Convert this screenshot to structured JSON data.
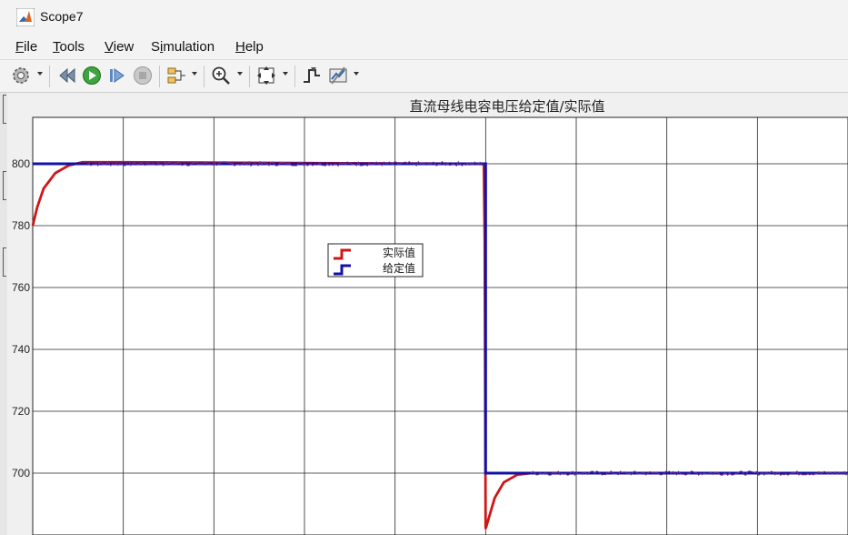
{
  "window": {
    "title": "Scope7",
    "app_icon": "matlab-icon"
  },
  "menu": {
    "items": [
      {
        "label": "File",
        "mnemonic": "F"
      },
      {
        "label": "Tools",
        "mnemonic": "T"
      },
      {
        "label": "View",
        "mnemonic": "V"
      },
      {
        "label": "Simulation",
        "mnemonic": "i"
      },
      {
        "label": "Help",
        "mnemonic": "H"
      }
    ]
  },
  "toolbar": {
    "buttons": [
      "settings-gear-icon",
      "step-back-icon",
      "run-icon",
      "step-forward-icon",
      "stop-icon",
      "highlight-signal-icon",
      "zoom-in-icon",
      "fit-to-view-icon",
      "triggers-icon",
      "measurements-icon"
    ]
  },
  "colors": {
    "actual": "#d01515",
    "setpoint": "#0f12a8",
    "grid": "#262626",
    "axes_bg": "#ffffff",
    "measured_trace": "#6a2a90"
  },
  "chart_data": {
    "type": "line",
    "title": "直流母线电容电压给定值/实际值",
    "ylim": [
      680,
      815
    ],
    "y_ticks": [
      700,
      720,
      740,
      760,
      780,
      800
    ],
    "x_divisions": 9,
    "grid": true,
    "legend_placement": "center-left",
    "series": [
      {
        "name": "实际值",
        "color": "#d01515",
        "points": [
          [
            0,
            780
          ],
          [
            0.05,
            786
          ],
          [
            0.12,
            792
          ],
          [
            0.25,
            797
          ],
          [
            0.4,
            799.5
          ],
          [
            0.55,
            800.5
          ],
          [
            1.0,
            800.5
          ],
          [
            4.98,
            800
          ],
          [
            4.99,
            775
          ],
          [
            5.0,
            682
          ],
          [
            5.04,
            686
          ],
          [
            5.1,
            692
          ],
          [
            5.2,
            697
          ],
          [
            5.35,
            699.5
          ],
          [
            5.5,
            700
          ],
          [
            9.0,
            700
          ]
        ]
      },
      {
        "name": "给定值",
        "color": "#0f12a8",
        "points": [
          [
            0,
            800
          ],
          [
            5.0,
            800
          ],
          [
            5.0,
            700
          ],
          [
            9.0,
            700
          ]
        ]
      }
    ]
  }
}
